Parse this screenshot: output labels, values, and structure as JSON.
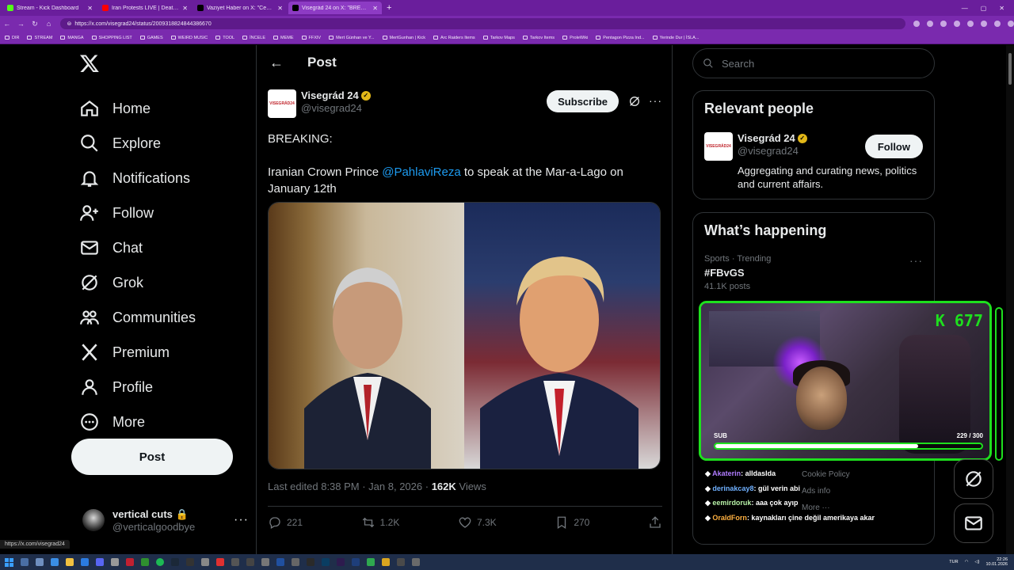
{
  "browser": {
    "tabs": [
      {
        "title": "Stream - Kick Dashboard",
        "color": "#53fc18"
      },
      {
        "title": "Iran Protests LIVE | Death Toll",
        "color": "#ff0000"
      },
      {
        "title": "Vaziyet Haber on X: \"Cenk hoca (R...",
        "color": "#000000"
      },
      {
        "title": "Visegrád 24 on X: \"BREAKING: Iran...",
        "color": "#000000"
      }
    ],
    "url": "https://x.com/visegrad24/status/2009318824844386670",
    "bookmarks": [
      "DIR",
      "STREAM",
      "MANGA",
      "SHOPPING LIST",
      "GAMES",
      "WEIRD MUSIC",
      "TOOL",
      "İNCELE",
      "MEME",
      "FFXIV",
      "Mert Günhan ve Y...",
      "MertGunhan | Kick",
      "Arc Raiders Items",
      "Tarkov Maps",
      "Tarkov Items",
      "ProleWiki",
      "Pentagon Pizza Ind...",
      "Yerinde Dur | İSLA..."
    ],
    "status_url": "https://x.com/visegrad24"
  },
  "sidebar": {
    "items": [
      {
        "label": "Home",
        "icon": "home-icon"
      },
      {
        "label": "Explore",
        "icon": "search-icon"
      },
      {
        "label": "Notifications",
        "icon": "bell-icon"
      },
      {
        "label": "Follow",
        "icon": "follow-icon"
      },
      {
        "label": "Chat",
        "icon": "mail-icon"
      },
      {
        "label": "Grok",
        "icon": "grok-icon"
      },
      {
        "label": "Communities",
        "icon": "communities-icon"
      },
      {
        "label": "Premium",
        "icon": "x-icon"
      },
      {
        "label": "Profile",
        "icon": "person-icon"
      },
      {
        "label": "More",
        "icon": "more-icon"
      }
    ],
    "post_label": "Post",
    "account": {
      "name": "vertical cuts",
      "handle": "@verticalgoodbye"
    }
  },
  "main": {
    "header": "Post",
    "tweet": {
      "author": "Visegrád 24",
      "handle": "@visegrad24",
      "avatar_text": "VISEGRÁD24",
      "subscribe": "Subscribe",
      "text_1": "BREAKING:",
      "text_2a": "Iranian Crown Prince ",
      "mention": "@PahlaviReza",
      "text_2b": " to speak at the Mar-a-Lago on January 12th",
      "edited": "Last edited 8:38 PM · Jan 8, 2026 · ",
      "views_count": "162K",
      "views_label": " Views",
      "replies": "221",
      "reposts": "1.2K",
      "likes": "7.3K",
      "bookmarks": "270"
    }
  },
  "right": {
    "search_placeholder": "Search",
    "relevant_title": "Relevant people",
    "person": {
      "name": "Visegrád 24",
      "handle": "@visegrad24",
      "avatar_text": "VISEGRÁD24",
      "bio": "Aggregating and curating news, politics and current affairs.",
      "follow": "Follow"
    },
    "happening_title": "What’s happening",
    "trend": {
      "category": "Sports · Trending",
      "tag": "#FBvGS",
      "count": "41.1K posts"
    },
    "footer": [
      "Cookie Policy",
      "Ads info",
      "More ···"
    ]
  },
  "stream_overlay": {
    "kick_count": "677",
    "sub_label": "SUB",
    "sub_progress": "229 / 300",
    "sub_fraction": 0.763,
    "chat": [
      {
        "user": "Akaterin",
        "msg": ": alldasIda",
        "cls": "u1"
      },
      {
        "user": "derinakcay8",
        "msg": ": gül verin abi",
        "cls": "u2"
      },
      {
        "user": "eemirdoruk",
        "msg": ": aaa çok ayıp",
        "cls": "u3"
      },
      {
        "user": "OraldForn",
        "msg": ": kaynakları çine değil amerikaya akar",
        "cls": "u4"
      }
    ]
  },
  "taskbar": {
    "lang": "TUR",
    "time": "22:26",
    "date": "10.01.2026"
  }
}
